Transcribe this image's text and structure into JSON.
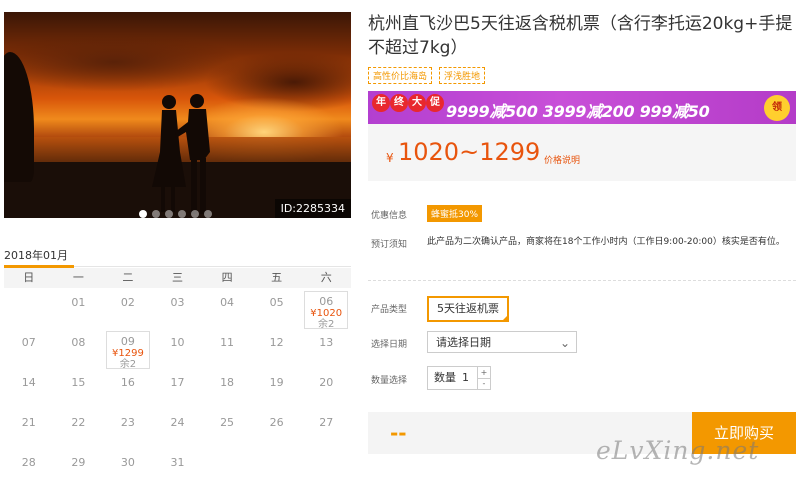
{
  "hero": {
    "image_id": "ID:2285334",
    "slide_count": 6,
    "active_slide": 1
  },
  "calendar": {
    "month": "2018年01月",
    "weekdays": [
      "日",
      "一",
      "二",
      "三",
      "四",
      "五",
      "六"
    ],
    "days": [
      "",
      "01",
      "02",
      "03",
      "04",
      "05",
      "06",
      "07",
      "08",
      "09",
      "10",
      "11",
      "12",
      "13",
      "14",
      "15",
      "16",
      "17",
      "18",
      "19",
      "20",
      "21",
      "22",
      "23",
      "24",
      "25",
      "26",
      "27",
      "28",
      "29",
      "30",
      "31"
    ],
    "available": [
      {
        "day": "06",
        "price": "¥1020",
        "remain": "余2"
      },
      {
        "day": "09",
        "price": "¥1299",
        "remain": "余2"
      }
    ]
  },
  "product": {
    "title": "杭州直飞沙巴5天往返含税机票（含行李托运20kg+手提不超过7kg）",
    "tags": [
      "高性价比海岛",
      "浮浅胜地"
    ],
    "promo": {
      "badge": [
        "年",
        "终",
        "大",
        "促"
      ],
      "offers": "9999减500  3999减200  999减50",
      "coin": "领"
    },
    "price": {
      "currency": "¥",
      "range": "1020~1299",
      "note": "价格说明"
    },
    "discount_label": "优惠信息",
    "discount_tag": "蜂蜜抵30%",
    "notice_label": "预订须知",
    "notice_text": "此产品为二次确认产品，商家将在18个工作小时内（工作日9:00-20:00）核实是否有位。",
    "type_label": "产品类型",
    "type_value": "5天往返机票",
    "date_label": "选择日期",
    "date_placeholder": "请选择日期",
    "qty_label": "数量选择",
    "qty_prefix": "数量",
    "qty_value": "1"
  },
  "buy": {
    "total": "--",
    "button": "立即购买"
  },
  "watermark": "eLvXing.net",
  "colors": {
    "accent": "#f39800",
    "price": "#e8540d",
    "promo_bg": "#c84fd8"
  }
}
